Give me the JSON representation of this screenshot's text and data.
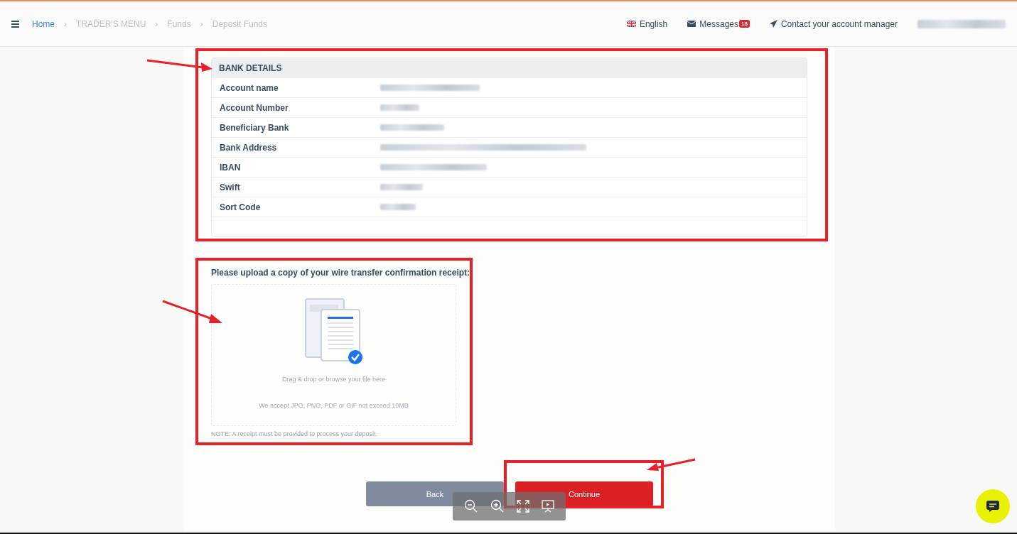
{
  "breadcrumbs": [
    {
      "label": "Home",
      "kind": "link"
    },
    {
      "label": "TRADER'S MENU",
      "kind": "muted"
    },
    {
      "label": "Funds",
      "kind": "muted"
    },
    {
      "label": "Deposit Funds",
      "kind": "muted"
    }
  ],
  "breadcrumb_separator": "›",
  "topbar": {
    "language": "English",
    "messages": "Messages",
    "messages_count": "18",
    "contact": "Contact your account manager"
  },
  "bank_details": {
    "title": "BANK DETAILS",
    "rows": [
      {
        "label": "Account name"
      },
      {
        "label": "Account Number"
      },
      {
        "label": "Beneficiary Bank"
      },
      {
        "label": "Bank Address"
      },
      {
        "label": "IBAN"
      },
      {
        "label": "Swift"
      },
      {
        "label": "Sort Code"
      }
    ]
  },
  "upload": {
    "title": "Please upload a copy of your wire transfer confirmation receipt:",
    "hint": "Drag & drop or browse your file here",
    "accept": "We accept JPG, PNG, PDF or GIF not exceed 10MB",
    "note": "NOTE: A receipt must be provided to process your deposit."
  },
  "buttons": [
    {
      "label": "Back",
      "kind": "secondary"
    },
    {
      "label": "Continue",
      "kind": "primary"
    }
  ]
}
